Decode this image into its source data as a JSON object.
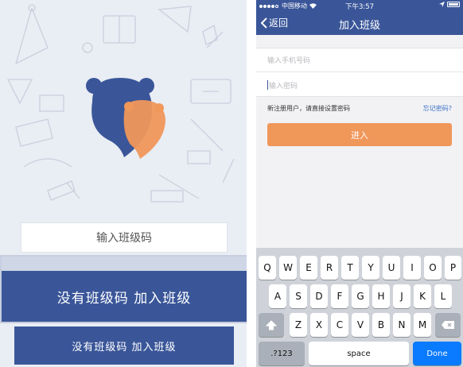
{
  "left": {
    "code_placeholder": "输入班级码",
    "big_button_label": "没有班级码 加入班级",
    "small_button_label": "没有班级码 加入班级",
    "colors": {
      "brand_blue": "#3a5699",
      "bg": "#e9edf4",
      "mascot_orange": "#f0975a"
    }
  },
  "phone": {
    "status": {
      "carrier": "中国移动",
      "time": "下午3:57"
    },
    "nav": {
      "back_label": "返回",
      "title": "加入班级"
    },
    "form": {
      "phone_placeholder": "输入手机号码",
      "password_placeholder": "输入密码"
    },
    "hint": "新注册用户，请直接设置密码",
    "forgot_label": "忘记密码?",
    "enter_label": "进入",
    "keyboard": {
      "row1": [
        "Q",
        "W",
        "E",
        "R",
        "T",
        "Y",
        "U",
        "I",
        "O",
        "P"
      ],
      "row2": [
        "A",
        "S",
        "D",
        "F",
        "G",
        "H",
        "J",
        "K",
        "L"
      ],
      "row3": [
        "Z",
        "X",
        "C",
        "V",
        "B",
        "N",
        "M"
      ],
      "numbers_label": ".?123",
      "space_label": "space",
      "done_label": "Done"
    },
    "colors": {
      "nav_blue": "#3a5699",
      "enter_orange": "#f0975a",
      "done_blue": "#0a7aff",
      "link_blue": "#3a6fc8"
    }
  }
}
